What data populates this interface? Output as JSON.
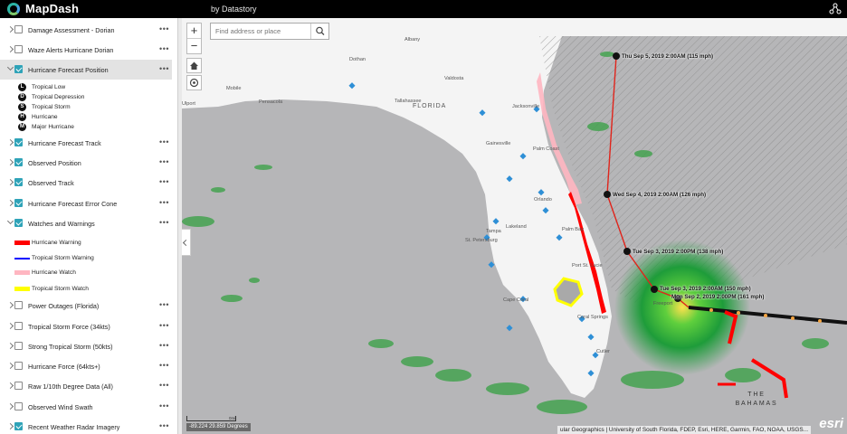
{
  "app": {
    "title": "MapDash",
    "byline": "by Datastory"
  },
  "layers": [
    {
      "label": "Damage Assessment - Dorian",
      "checked": false
    },
    {
      "label": "Waze Alerts Hurricane Dorian",
      "checked": false
    },
    {
      "label": "Hurricane Forecast Position",
      "checked": true
    },
    {
      "label": "Hurricane Forecast Track",
      "checked": true
    },
    {
      "label": "Observed Position",
      "checked": true
    },
    {
      "label": "Observed Track",
      "checked": true
    },
    {
      "label": "Hurricane Forecast Error Cone",
      "checked": true
    },
    {
      "label": "Watches and Warnings",
      "checked": true
    },
    {
      "label": "Power Outages (Florida)",
      "checked": false
    },
    {
      "label": "Tropical Storm Force (34kts)",
      "checked": false
    },
    {
      "label": "Strong Tropical Storm (50kts)",
      "checked": false
    },
    {
      "label": "Hurricane Force (64kts+)",
      "checked": false
    },
    {
      "label": "Raw 1/10th Degree Data (All)",
      "checked": false
    },
    {
      "label": "Observed Wind Swath",
      "checked": false
    },
    {
      "label": "Recent Weather Radar Imagery",
      "checked": true
    }
  ],
  "position_legend": [
    {
      "symbol": "L",
      "label": "Tropical Low"
    },
    {
      "symbol": "D",
      "label": "Tropical Depression"
    },
    {
      "symbol": "S",
      "label": "Tropical Storm"
    },
    {
      "symbol": "H",
      "label": "Hurricane"
    },
    {
      "symbol": "M",
      "label": "Major Hurricane"
    }
  ],
  "warnings_legend": [
    {
      "label": "Hurricane Warning",
      "color": "#ff0000"
    },
    {
      "label": "Tropical Storm Warning",
      "color": "#0000ff"
    },
    {
      "label": "Hurricane Watch",
      "color": "#ffb6c1"
    },
    {
      "label": "Tropical Storm Watch",
      "color": "#ffff00"
    }
  ],
  "map": {
    "search_placeholder": "Find address or place",
    "zoom_in": "+",
    "zoom_out": "−",
    "places": [
      "Albany",
      "Dothan",
      "Valdosta",
      "Mobile",
      "Pensacola",
      "Tallahassee",
      "Jacksonville",
      "Gainesville",
      "Palm Coast",
      "Orlando",
      "Lakeland",
      "Tampa",
      "St. Petersburg",
      "Palm Bay",
      "Port St. Lucie",
      "Cape Coral",
      "Coral Springs",
      "Freeport",
      "Cutler",
      "Ulport"
    ],
    "state_label": "FLORIDA",
    "country_label": "THE BAHAMAS",
    "track_labels": [
      "Thu Sep 5, 2019 2:00AM (115 mph)",
      "Wed Sep 4, 2019 2:00AM (126 mph)",
      "Tue Sep 3, 2019 2:00PM (138 mph)",
      "Tue Sep 3, 2019 2:00AM (150 mph)",
      "Mon Sep 2, 2019 2:00PM (161 mph)"
    ],
    "scale_label": "0mi",
    "coordinates": "-89.224 29.859 Degrees",
    "attribution": "ular Geographics | University of South Florida, FDEP, Esri, HERE, Garmin, FAO, NOAA, USGS...",
    "esri": "esri",
    "colors": {
      "land": "#f4f4f4",
      "water": "#b6b6b8",
      "track": "#e0241b",
      "cone": "#9a9a9a"
    }
  }
}
